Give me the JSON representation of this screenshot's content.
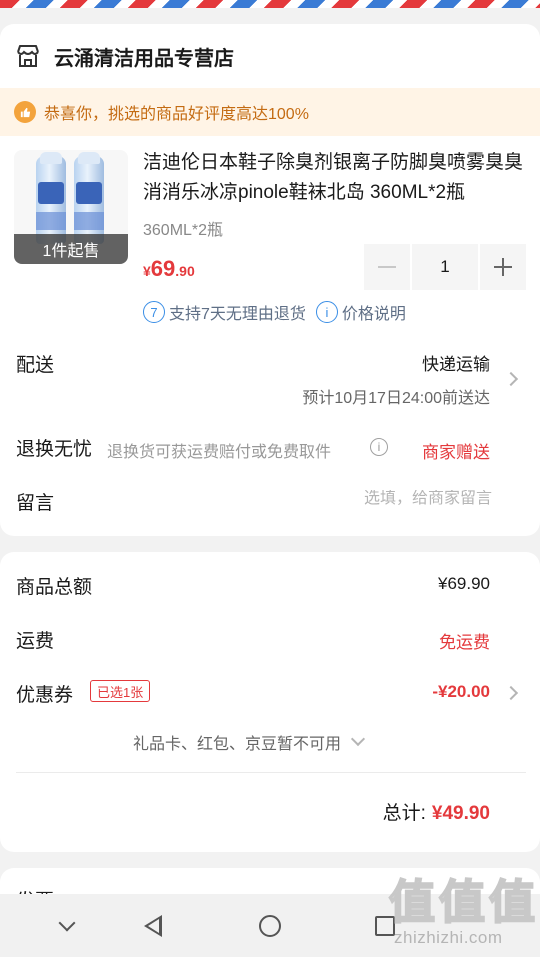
{
  "store": {
    "name": "云涌清洁用品专营店",
    "congrats": "恭喜你，挑选的商品好评度高达100%"
  },
  "product": {
    "title": "洁迪伦日本鞋子除臭剂银离子防脚臭喷雾臭臭消消乐冰凉pinole鞋袜北岛 360ML*2瓶",
    "spec": "360ML*2瓶",
    "min_badge": "1件起售",
    "price_symbol": "¥",
    "price_int": "69",
    "price_dec": ".90",
    "quantity": "1",
    "service_badge": "7",
    "service_text": "支持7天无理由退货",
    "price_info_icon": "i",
    "price_info_text": "价格说明"
  },
  "delivery": {
    "label": "配送",
    "method": "快递运输",
    "eta": "预计10月17日24:00前送达"
  },
  "returns": {
    "label": "退换无忧",
    "desc": "退换货可获运费赔付或免费取件",
    "info_icon": "i",
    "gift": "商家赠送"
  },
  "note": {
    "label": "留言",
    "placeholder": "选填，给商家留言"
  },
  "summary": {
    "goods_label": "商品总额",
    "goods_value": "¥69.90",
    "shipping_label": "运费",
    "shipping_value": "免运费",
    "coupon_label": "优惠券",
    "coupon_chip": "已选1张",
    "coupon_value": "-¥20.00",
    "unavailable": "礼品卡、红包、京豆暂不可用",
    "total_label": "总计:",
    "total_value": "¥49.90"
  },
  "invoice": {
    "label": "发票"
  },
  "watermark": {
    "glyphs": [
      "值",
      "值",
      "值"
    ],
    "url": "zhizhizhi.com"
  },
  "colors": {
    "accent_red": "#e4393c",
    "notice_bg": "#fff4e6",
    "notice_text": "#c46b12",
    "service_blue": "#3a8ee6"
  },
  "icons": {
    "store": "store-icon",
    "thumb": "thumb-up-icon",
    "info": "info-icon",
    "chevron": "chevron-right-icon",
    "nav": [
      "nav-down-icon",
      "nav-back-icon",
      "nav-home-icon",
      "nav-recent-icon"
    ]
  }
}
